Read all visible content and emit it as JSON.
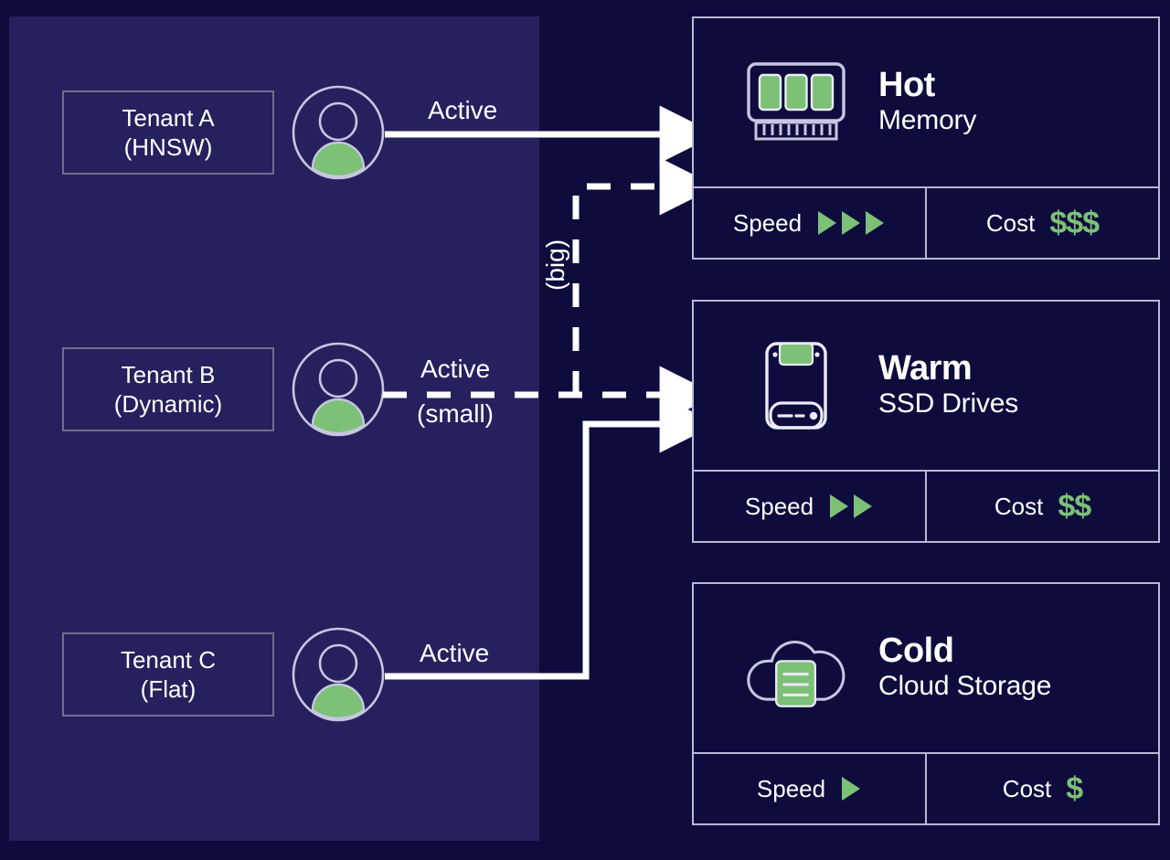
{
  "colors": {
    "background": "#0e0c3d",
    "panel": "#25215e",
    "accent_green": "#7cc176",
    "line": "#ffffff",
    "card_border": "#b8b8d8",
    "box_border": "#6f6f8e"
  },
  "tenants": [
    {
      "name": "Tenant A",
      "index": "(HNSW)",
      "avatar_icon": "user-avatar-icon"
    },
    {
      "name": "Tenant B",
      "index": "(Dynamic)",
      "avatar_icon": "user-avatar-icon"
    },
    {
      "name": "Tenant C",
      "index": "(Flat)",
      "avatar_icon": "user-avatar-icon"
    }
  ],
  "edges": [
    {
      "id": "tenant-a-to-hot",
      "label": "Active",
      "sublabel": "",
      "style": "solid",
      "from": "Tenant A",
      "to": "Hot"
    },
    {
      "id": "tenant-b-to-hot",
      "label": "(big)",
      "sublabel": "",
      "style": "dashed",
      "from": "Tenant B",
      "to": "Hot"
    },
    {
      "id": "tenant-b-to-warm",
      "label": "Active",
      "sublabel": "(small)",
      "style": "dashed",
      "from": "Tenant B",
      "to": "Warm"
    },
    {
      "id": "tenant-c-to-warm",
      "label": "Active",
      "sublabel": "",
      "style": "solid",
      "from": "Tenant C",
      "to": "Warm"
    }
  ],
  "tiers": [
    {
      "name": "Hot",
      "subtitle": "Memory",
      "icon": "memory-ram-icon",
      "speed_label": "Speed",
      "speed_level": 3,
      "cost_label": "Cost",
      "cost_value": "$$$"
    },
    {
      "name": "Warm",
      "subtitle": "SSD Drives",
      "icon": "ssd-drive-icon",
      "speed_label": "Speed",
      "speed_level": 2,
      "cost_label": "Cost",
      "cost_value": "$$"
    },
    {
      "name": "Cold",
      "subtitle": "Cloud Storage",
      "icon": "cloud-storage-icon",
      "speed_label": "Speed",
      "speed_level": 1,
      "cost_label": "Cost",
      "cost_value": "$"
    }
  ]
}
